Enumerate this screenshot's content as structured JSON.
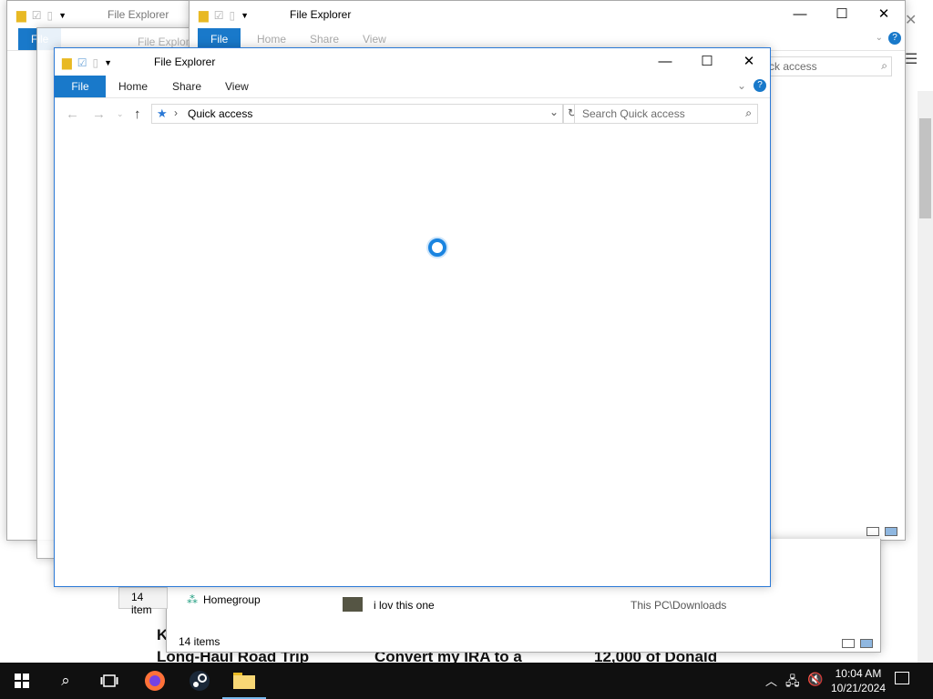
{
  "app_title": "File Explorer",
  "ribbon": {
    "file": "File",
    "home": "Home",
    "share": "Share",
    "view": "View"
  },
  "address": {
    "location": "Quick access",
    "search_placeholder": "Search Quick access"
  },
  "search_partial": "ck access",
  "back_window": {
    "nav_homegroup": "Homegroup",
    "item_name": "i lov this one",
    "item_location": "This PC\\Downloads",
    "status_items": "14 items",
    "status_items_partial": "14 item"
  },
  "browser_news": {
    "headline1": "Long-Haul Road Trip",
    "headline2": "Convert my IRA to a",
    "headline3": "12,000 of Donald",
    "fragment": "K"
  },
  "taskbar": {
    "time": "10:04 AM",
    "date": "10/21/2024",
    "pinned": [
      "start-icon",
      "search-icon",
      "task-view-icon",
      "firefox-icon",
      "steam-icon",
      "file-explorer-icon"
    ]
  },
  "colors": {
    "accent": "#1979ca",
    "window_border": "#2b79d6",
    "taskbar": "#101010",
    "spinner": "#1a84e0"
  }
}
